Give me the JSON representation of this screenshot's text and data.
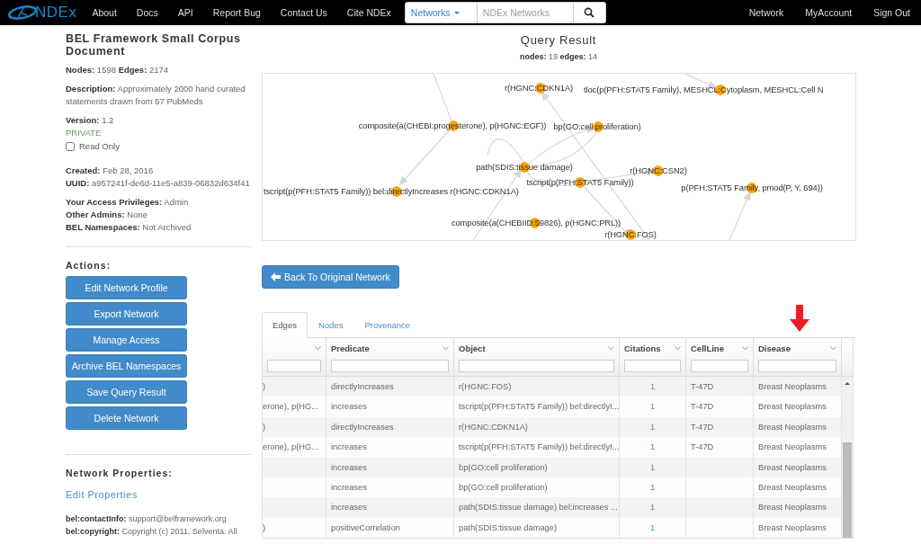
{
  "navbar": {
    "logo": "NDEx",
    "links": [
      "About",
      "Docs",
      "API",
      "Report Bug",
      "Contact Us",
      "Cite NDEx"
    ],
    "search": {
      "scope": "Networks",
      "placeholder": "NDEx Networks"
    },
    "right_links": [
      "Network",
      "MyAccount",
      "Sign Out"
    ]
  },
  "network": {
    "title": "BEL Framework Small Corpus Document",
    "stats": "**Nodes:** 1598 **Edges:** 2174",
    "description": "**Description:** Approximately 2000 hand curated statements drawn from 57 PubMeds",
    "version": "**Version:** 1.2",
    "visibility": "PRIVATE",
    "read_only": {
      "label": "Read Only",
      "checked": false
    },
    "created": "**Created:** Feb 28, 2016",
    "uuid": "**UUID:** a957241f-de6d-11e5-a839-06832d634f41",
    "access": [
      "**Your Access Privileges:** Admin",
      "**Other Admins:** None",
      "**BEL Namespaces:** Not Archived"
    ]
  },
  "actions": {
    "title": "Actions:",
    "buttons": [
      "Edit Network Profile",
      "Export Network",
      "Manage Access",
      "Archive BEL Namespaces",
      "Save Query Result",
      "Delete Network"
    ]
  },
  "properties": {
    "title": "Network Properties:",
    "edit_link": "Edit Properties",
    "items": [
      "**bel:contactInfo:** support@belframework.org",
      "**bel:copyright:** Copyright (c) 2011, Selventa. All"
    ]
  },
  "query_result": {
    "title": "Query Result",
    "stats": "**nodes:** 19 **edges:** 14",
    "graph": {
      "nodes": [
        {
          "label": "r(HGNC:CDKN1A)"
        },
        {
          "label": "tloc(p(PFH:STAT5 Family), MESHCL:Cytoplasm, MESHCL:Cell N"
        },
        {
          "label": "composite(a(CHEBI:progesterone), p(HGNC:EGF))"
        },
        {
          "label": "bp(GO:cell proliferation)"
        },
        {
          "label": "path(SDIS:tissue damage)"
        },
        {
          "label": "r(HGNC:CSN2)"
        },
        {
          "label": "tscript(p(PFH:STAT5 Family))"
        },
        {
          "label": "p(PFH:STAT5 Family, pmod(P, Y, 694))"
        },
        {
          "label": "tscript(p(PFH:STAT5 Family)) bel:directlyIncreases r(HGNC:CDKN1A)"
        },
        {
          "label": "composite(a(CHEBIID:59826), p(HGNC:PRL))"
        },
        {
          "label": "r(HGNC:FOS)"
        }
      ]
    },
    "back_button": "Back To Original Network"
  },
  "tabs": [
    {
      "label": "Edges",
      "selected": true
    },
    {
      "label": "Nodes",
      "selected": false
    },
    {
      "label": "Provenance",
      "selected": false
    }
  ],
  "table": {
    "columns": [
      {},
      {
        "label": "Predicate"
      },
      {
        "label": "Object"
      },
      {
        "label": "Citations"
      },
      {
        "label": "CellLine"
      },
      {
        "label": "Disease"
      }
    ],
    "rows": [
      {
        "subject": ")",
        "predicate": "directlyIncreases",
        "object": "r(HGNC:FOS)",
        "citations": "1",
        "cell_line": "T-47D",
        "disease": "Breast Neoplasms"
      },
      {
        "subject": "erone), p(HG...",
        "predicate": "increases",
        "object": "tscript(p(PFH:STAT5 Family)) bel:directlyI...",
        "citations": "1",
        "cell_line": "T-47D",
        "disease": "Breast Neoplasms"
      },
      {
        "subject": ")",
        "predicate": "directlyIncreases",
        "object": "r(HGNC:CDKN1A)",
        "citations": "1",
        "cell_line": "T-47D",
        "disease": "Breast Neoplasms"
      },
      {
        "subject": "erone), p(HG...",
        "predicate": "increases",
        "object": "tscript(p(PFH:STAT5 Family)) bel:directlyI...",
        "citations": "1",
        "cell_line": "T-47D",
        "disease": "Breast Neoplasms"
      },
      {
        "predicate": "increases",
        "object": "bp(GO:cell proliferation)",
        "citations": "1",
        "disease": "Breast Neoplasms"
      },
      {
        "predicate": "increases",
        "object": "bp(GO:cell proliferation)",
        "citations": "1",
        "disease": "Breast Neoplasms"
      },
      {
        "predicate": "increases",
        "object": "path(SDIS:tissue damage) bel:increases ...",
        "citations": "1",
        "disease": "Breast Neoplasms"
      },
      {
        "subject": ")",
        "predicate": "positiveCorrelation",
        "object": "path(SDIS:tissue damage)",
        "citations": "1",
        "disease": "Breast Neoplasms"
      }
    ]
  }
}
